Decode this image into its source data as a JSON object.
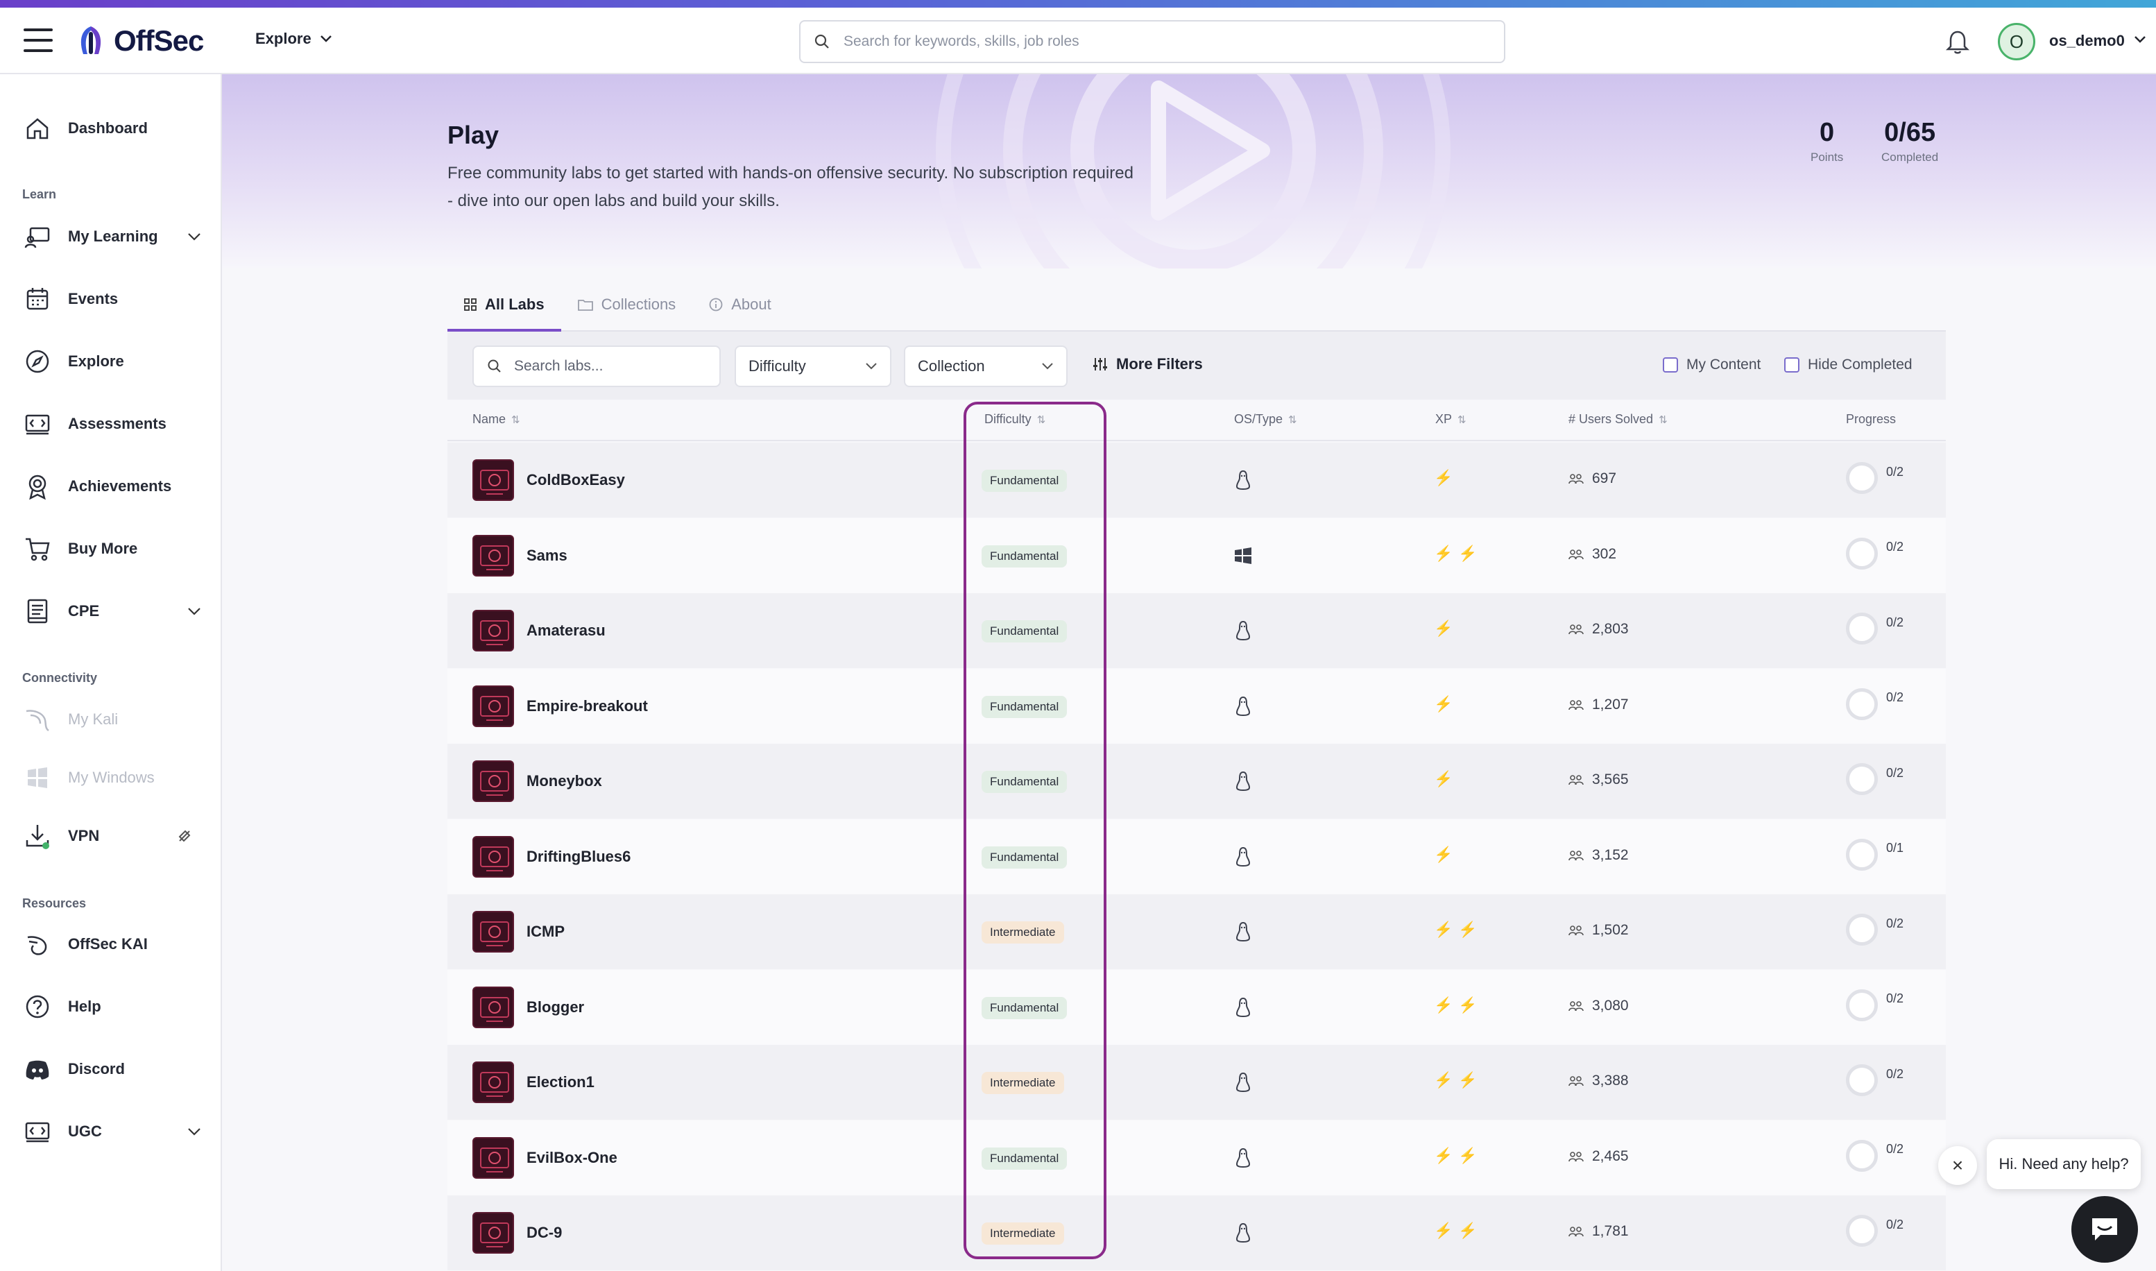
{
  "header": {
    "brand": "OffSec",
    "explore_label": "Explore",
    "search_placeholder": "Search for keywords, skills, job roles",
    "username": "os_demo0",
    "avatar_initial": "O"
  },
  "sidebar": {
    "items": [
      {
        "label": "Dashboard",
        "icon": "home-icon"
      },
      {
        "label": "My Learning",
        "icon": "learning-icon"
      },
      {
        "label": "Events",
        "icon": "calendar-icon"
      },
      {
        "label": "Explore",
        "icon": "compass-icon"
      },
      {
        "label": "Assessments",
        "icon": "assessment-icon"
      },
      {
        "label": "Achievements",
        "icon": "badge-icon"
      },
      {
        "label": "Buy More",
        "icon": "cart-icon"
      },
      {
        "label": "CPE",
        "icon": "document-icon"
      },
      {
        "label": "My Kali",
        "icon": "kali-dragon-icon"
      },
      {
        "label": "My Windows",
        "icon": "windows-icon"
      },
      {
        "label": "VPN",
        "icon": "download-icon"
      },
      {
        "label": "OffSec KAI",
        "icon": "kai-icon"
      },
      {
        "label": "Help",
        "icon": "help-icon"
      },
      {
        "label": "Discord",
        "icon": "discord-icon"
      },
      {
        "label": "UGC",
        "icon": "ugc-icon"
      }
    ],
    "sections": {
      "learn": "Learn",
      "connectivity": "Connectivity",
      "resources": "Resources"
    }
  },
  "hero": {
    "title": "Play",
    "description": "Free community labs to get started with hands-on offensive security. No subscription required - dive into our open labs and build your skills.",
    "points_value": "0",
    "points_label": "Points",
    "completed_value": "0/65",
    "completed_label": "Completed"
  },
  "tabs": [
    "All Labs",
    "Collections",
    "About"
  ],
  "filters": {
    "search_placeholder": "Search labs...",
    "difficulty": "Difficulty",
    "collection": "Collection",
    "more_filters": "More Filters",
    "my_content": "My Content",
    "hide_completed": "Hide Completed"
  },
  "table": {
    "headers": [
      "Name",
      "Difficulty",
      "OS/Type",
      "XP",
      "# Users Solved",
      "Progress"
    ],
    "rows": [
      {
        "name": "ColdBoxEasy",
        "difficulty": "Fundamental",
        "os": "linux",
        "xp": "⚡",
        "solved": "697",
        "progress": "0/2"
      },
      {
        "name": "Sams",
        "difficulty": "Fundamental",
        "os": "windows",
        "xp": "⚡⚡",
        "solved": "302",
        "progress": "0/2"
      },
      {
        "name": "Amaterasu",
        "difficulty": "Fundamental",
        "os": "linux",
        "xp": "⚡",
        "solved": "2,803",
        "progress": "0/2"
      },
      {
        "name": "Empire-breakout",
        "difficulty": "Fundamental",
        "os": "linux",
        "xp": "⚡",
        "solved": "1,207",
        "progress": "0/2"
      },
      {
        "name": "Moneybox",
        "difficulty": "Fundamental",
        "os": "linux",
        "xp": "⚡",
        "solved": "3,565",
        "progress": "0/2"
      },
      {
        "name": "DriftingBlues6",
        "difficulty": "Fundamental",
        "os": "linux",
        "xp": "⚡",
        "solved": "3,152",
        "progress": "0/1"
      },
      {
        "name": "ICMP",
        "difficulty": "Intermediate",
        "os": "linux",
        "xp": "⚡⚡",
        "solved": "1,502",
        "progress": "0/2"
      },
      {
        "name": "Blogger",
        "difficulty": "Fundamental",
        "os": "linux",
        "xp": "⚡⚡",
        "solved": "3,080",
        "progress": "0/2"
      },
      {
        "name": "Election1",
        "difficulty": "Intermediate",
        "os": "linux",
        "xp": "⚡⚡",
        "solved": "3,388",
        "progress": "0/2"
      },
      {
        "name": "EvilBox-One",
        "difficulty": "Fundamental",
        "os": "linux",
        "xp": "⚡⚡",
        "solved": "2,465",
        "progress": "0/2"
      },
      {
        "name": "DC-9",
        "difficulty": "Intermediate",
        "os": "linux",
        "xp": "⚡⚡",
        "solved": "1,781",
        "progress": "0/2"
      }
    ]
  },
  "chat": {
    "message": "Hi. Need any help?",
    "close": "×"
  },
  "colors": {
    "accent": "#7a4dc8",
    "highlight": "#8a2a8a",
    "fundamental": "#e2eee5",
    "intermediate": "#f7e7d6"
  }
}
